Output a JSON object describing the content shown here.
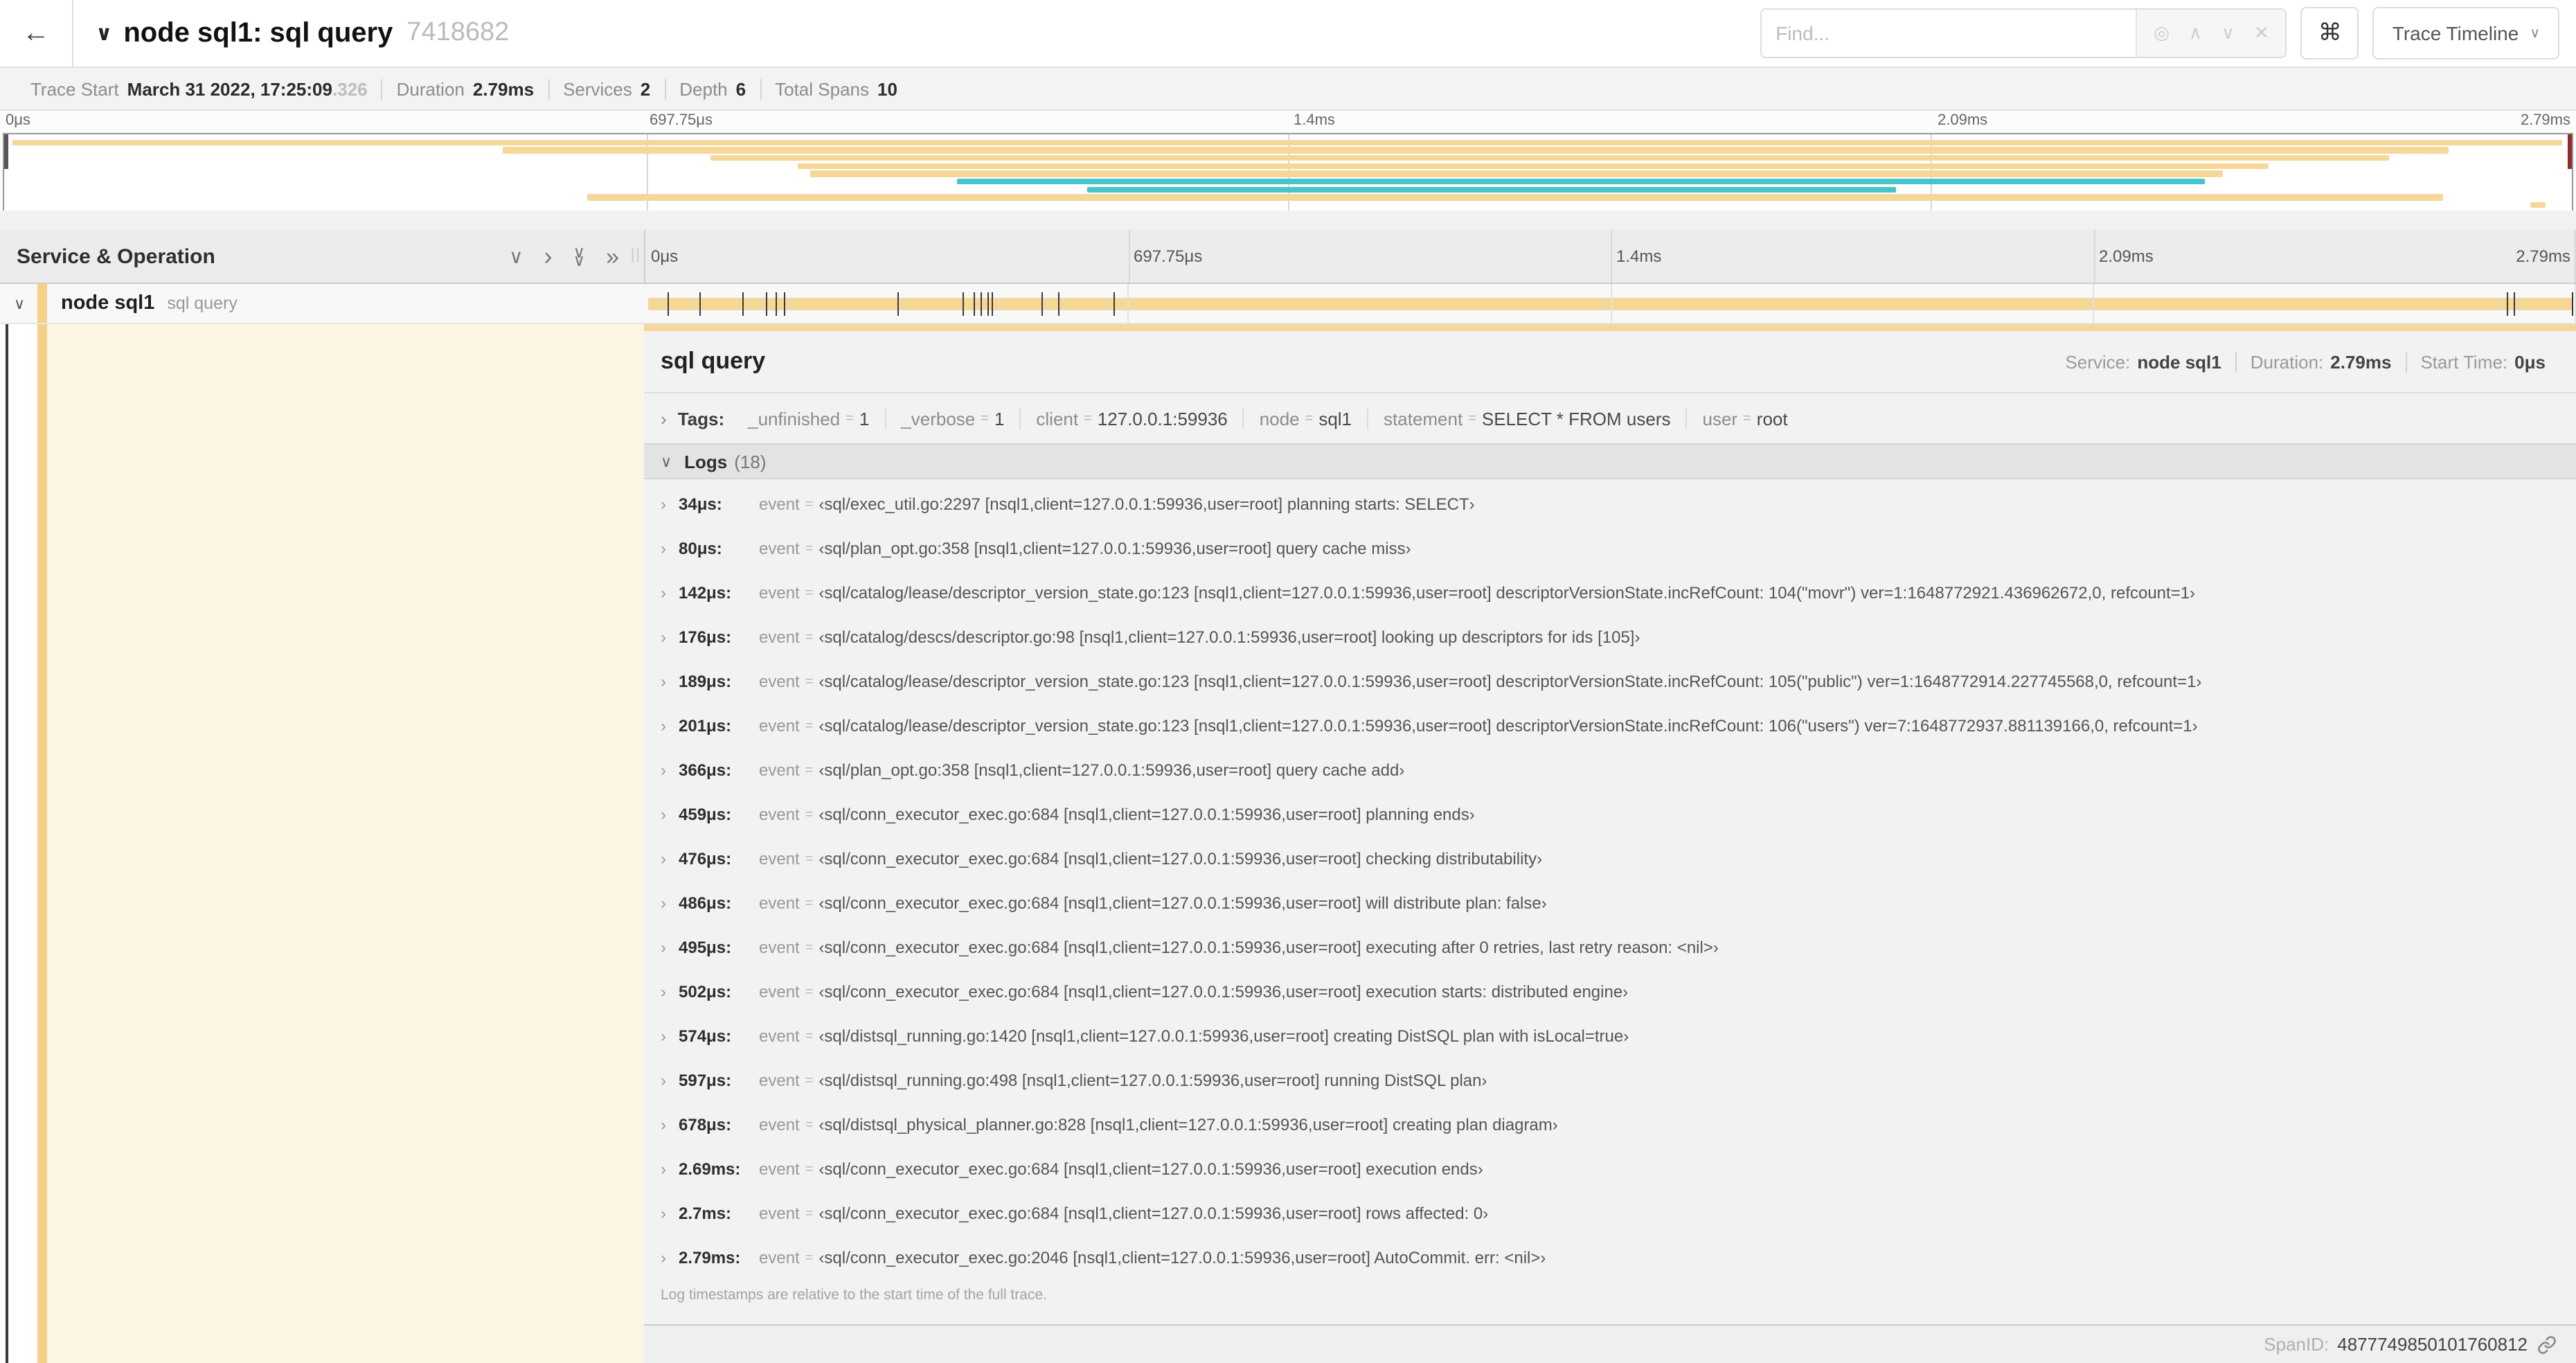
{
  "icons": {
    "back": "←",
    "chevron_down": "∨",
    "chevron_right": "›",
    "double_chevron_right": "»",
    "locate": "◎",
    "find_up": "∧",
    "find_down": "∨",
    "find_close": "✕",
    "command": "⌘",
    "caret_down": "∨",
    "drag_handle": "||"
  },
  "header": {
    "title": "node sql1: sql query",
    "trace_id": "7418682",
    "find_placeholder": "Find...",
    "view_selector_label": "Trace Timeline"
  },
  "trace_info": {
    "items": [
      {
        "label": "Trace Start",
        "value": "March 31 2022, 17:25:09",
        "suffix": ".326"
      },
      {
        "label": "Duration",
        "value": "2.79ms",
        "suffix": ""
      },
      {
        "label": "Services",
        "value": "2",
        "suffix": ""
      },
      {
        "label": "Depth",
        "value": "6",
        "suffix": ""
      },
      {
        "label": "Total Spans",
        "value": "10",
        "suffix": ""
      }
    ]
  },
  "timeline": {
    "ticks": [
      "0μs",
      "697.75μs",
      "1.4ms",
      "2.09ms",
      "2.79ms"
    ],
    "tick_positions": [
      0,
      25,
      50,
      75,
      100
    ],
    "duration_us": 2790
  },
  "minimap": {
    "spans": [
      {
        "row": 0,
        "start_pct": 0.3,
        "end_pct": 99.6,
        "color": "amber"
      },
      {
        "row": 1,
        "start_pct": 19.4,
        "end_pct": 95.2,
        "color": "amber"
      },
      {
        "row": 2,
        "start_pct": 27.5,
        "end_pct": 92.9,
        "color": "amber"
      },
      {
        "row": 3,
        "start_pct": 30.9,
        "end_pct": 88.2,
        "color": "amber"
      },
      {
        "row": 4,
        "start_pct": 31.4,
        "end_pct": 86.4,
        "color": "amber"
      },
      {
        "row": 5,
        "start_pct": 37.1,
        "end_pct": 85.7,
        "color": "teal"
      },
      {
        "row": 6,
        "start_pct": 42.2,
        "end_pct": 73.7,
        "color": "teal"
      },
      {
        "row": 7,
        "start_pct": 22.7,
        "end_pct": 95.0,
        "color": "amber"
      },
      {
        "row": 8,
        "start_pct": 98.4,
        "end_pct": 99.0,
        "color": "amber"
      }
    ]
  },
  "span_list": {
    "header_title": "Service & Operation",
    "row": {
      "service": "node sql1",
      "operation": "sql query"
    }
  },
  "detail": {
    "title": "sql query",
    "service_label": "Service:",
    "service": "node sql1",
    "duration_label": "Duration:",
    "duration": "2.79ms",
    "start_label": "Start Time:",
    "start": "0μs",
    "tags_label": "Tags:",
    "eq": "=",
    "tags": [
      {
        "key": "_unfinished",
        "value": "1"
      },
      {
        "key": "_verbose",
        "value": "1"
      },
      {
        "key": "client",
        "value": "127.0.0.1:59936"
      },
      {
        "key": "node",
        "value": "sql1"
      },
      {
        "key": "statement",
        "value": "SELECT * FROM users"
      },
      {
        "key": "user",
        "value": "root"
      }
    ],
    "logs_label": "Logs",
    "logs_count": "(18)",
    "event_key": "event",
    "logs": [
      {
        "time": "34μs:",
        "t_us": 34,
        "value": "‹sql/exec_util.go:2297 [nsql1,client=127.0.0.1:59936,user=root] planning starts: SELECT›"
      },
      {
        "time": "80μs:",
        "t_us": 80,
        "value": "‹sql/plan_opt.go:358 [nsql1,client=127.0.0.1:59936,user=root] query cache miss›"
      },
      {
        "time": "142μs:",
        "t_us": 142,
        "value": "‹sql/catalog/lease/descriptor_version_state.go:123 [nsql1,client=127.0.0.1:59936,user=root] descriptorVersionState.incRefCount: 104(\"movr\") ver=1:1648772921.436962672,0, refcount=1›"
      },
      {
        "time": "176μs:",
        "t_us": 176,
        "value": "‹sql/catalog/descs/descriptor.go:98 [nsql1,client=127.0.0.1:59936,user=root] looking up descriptors for ids [105]›"
      },
      {
        "time": "189μs:",
        "t_us": 189,
        "value": "‹sql/catalog/lease/descriptor_version_state.go:123 [nsql1,client=127.0.0.1:59936,user=root] descriptorVersionState.incRefCount: 105(\"public\") ver=1:1648772914.227745568,0, refcount=1›"
      },
      {
        "time": "201μs:",
        "t_us": 201,
        "value": "‹sql/catalog/lease/descriptor_version_state.go:123 [nsql1,client=127.0.0.1:59936,user=root] descriptorVersionState.incRefCount: 106(\"users\") ver=7:1648772937.881139166,0, refcount=1›"
      },
      {
        "time": "366μs:",
        "t_us": 366,
        "value": "‹sql/plan_opt.go:358 [nsql1,client=127.0.0.1:59936,user=root] query cache add›"
      },
      {
        "time": "459μs:",
        "t_us": 459,
        "value": "‹sql/conn_executor_exec.go:684 [nsql1,client=127.0.0.1:59936,user=root] planning ends›"
      },
      {
        "time": "476μs:",
        "t_us": 476,
        "value": "‹sql/conn_executor_exec.go:684 [nsql1,client=127.0.0.1:59936,user=root] checking distributability›"
      },
      {
        "time": "486μs:",
        "t_us": 486,
        "value": "‹sql/conn_executor_exec.go:684 [nsql1,client=127.0.0.1:59936,user=root] will distribute plan: false›"
      },
      {
        "time": "495μs:",
        "t_us": 495,
        "value": "‹sql/conn_executor_exec.go:684 [nsql1,client=127.0.0.1:59936,user=root] executing after 0 retries, last retry reason: <nil>›"
      },
      {
        "time": "502μs:",
        "t_us": 502,
        "value": "‹sql/conn_executor_exec.go:684 [nsql1,client=127.0.0.1:59936,user=root] execution starts: distributed engine›"
      },
      {
        "time": "574μs:",
        "t_us": 574,
        "value": "‹sql/distsql_running.go:1420 [nsql1,client=127.0.0.1:59936,user=root] creating DistSQL plan with isLocal=true›"
      },
      {
        "time": "597μs:",
        "t_us": 597,
        "value": "‹sql/distsql_running.go:498 [nsql1,client=127.0.0.1:59936,user=root] running DistSQL plan›"
      },
      {
        "time": "678μs:",
        "t_us": 678,
        "value": "‹sql/distsql_physical_planner.go:828 [nsql1,client=127.0.0.1:59936,user=root] creating plan diagram›"
      },
      {
        "time": "2.69ms:",
        "t_us": 2690,
        "value": "‹sql/conn_executor_exec.go:684 [nsql1,client=127.0.0.1:59936,user=root] execution ends›"
      },
      {
        "time": "2.7ms:",
        "t_us": 2700,
        "value": "‹sql/conn_executor_exec.go:684 [nsql1,client=127.0.0.1:59936,user=root] rows affected: 0›"
      },
      {
        "time": "2.79ms:",
        "t_us": 2790,
        "value": "‹sql/conn_executor_exec.go:2046 [nsql1,client=127.0.0.1:59936,user=root] AutoCommit. err: <nil>›"
      }
    ],
    "footnote": "Log timestamps are relative to the start time of the full trace.",
    "spanid_label": "SpanID:",
    "spanid": "4877749850101760812"
  },
  "colors": {
    "amber": "#f5d899",
    "accent": "#f5d089",
    "teal": "#45c4c9",
    "cream": "#fcf5e3",
    "handle_red": "#8b2c2c"
  }
}
